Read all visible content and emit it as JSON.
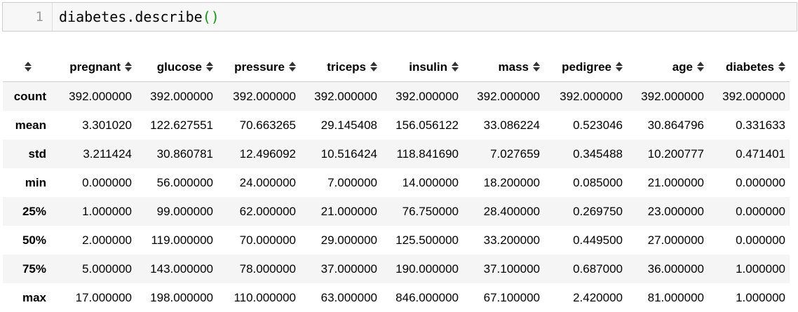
{
  "cell": {
    "line_number": "1",
    "code_prefix": "diabetes.describe",
    "code_parens": "()"
  },
  "table": {
    "columns": [
      "pregnant",
      "glucose",
      "pressure",
      "triceps",
      "insulin",
      "mass",
      "pedigree",
      "age",
      "diabetes"
    ],
    "rows": [
      {
        "label": "count",
        "values": [
          "392.000000",
          "392.000000",
          "392.000000",
          "392.000000",
          "392.000000",
          "392.000000",
          "392.000000",
          "392.000000",
          "392.000000"
        ]
      },
      {
        "label": "mean",
        "values": [
          "3.301020",
          "122.627551",
          "70.663265",
          "29.145408",
          "156.056122",
          "33.086224",
          "0.523046",
          "30.864796",
          "0.331633"
        ]
      },
      {
        "label": "std",
        "values": [
          "3.211424",
          "30.860781",
          "12.496092",
          "10.516424",
          "118.841690",
          "7.027659",
          "0.345488",
          "10.200777",
          "0.471401"
        ]
      },
      {
        "label": "min",
        "values": [
          "0.000000",
          "56.000000",
          "24.000000",
          "7.000000",
          "14.000000",
          "18.200000",
          "0.085000",
          "21.000000",
          "0.000000"
        ]
      },
      {
        "label": "25%",
        "values": [
          "1.000000",
          "99.000000",
          "62.000000",
          "21.000000",
          "76.750000",
          "28.400000",
          "0.269750",
          "23.000000",
          "0.000000"
        ]
      },
      {
        "label": "50%",
        "values": [
          "2.000000",
          "119.000000",
          "70.000000",
          "29.000000",
          "125.500000",
          "33.200000",
          "0.449500",
          "27.000000",
          "0.000000"
        ]
      },
      {
        "label": "75%",
        "values": [
          "5.000000",
          "143.000000",
          "78.000000",
          "37.000000",
          "190.000000",
          "37.100000",
          "0.687000",
          "36.000000",
          "1.000000"
        ]
      },
      {
        "label": "max",
        "values": [
          "17.000000",
          "198.000000",
          "110.000000",
          "63.000000",
          "846.000000",
          "67.100000",
          "2.420000",
          "81.000000",
          "1.000000"
        ]
      }
    ]
  },
  "icons": {
    "sort": "sort-icon"
  }
}
